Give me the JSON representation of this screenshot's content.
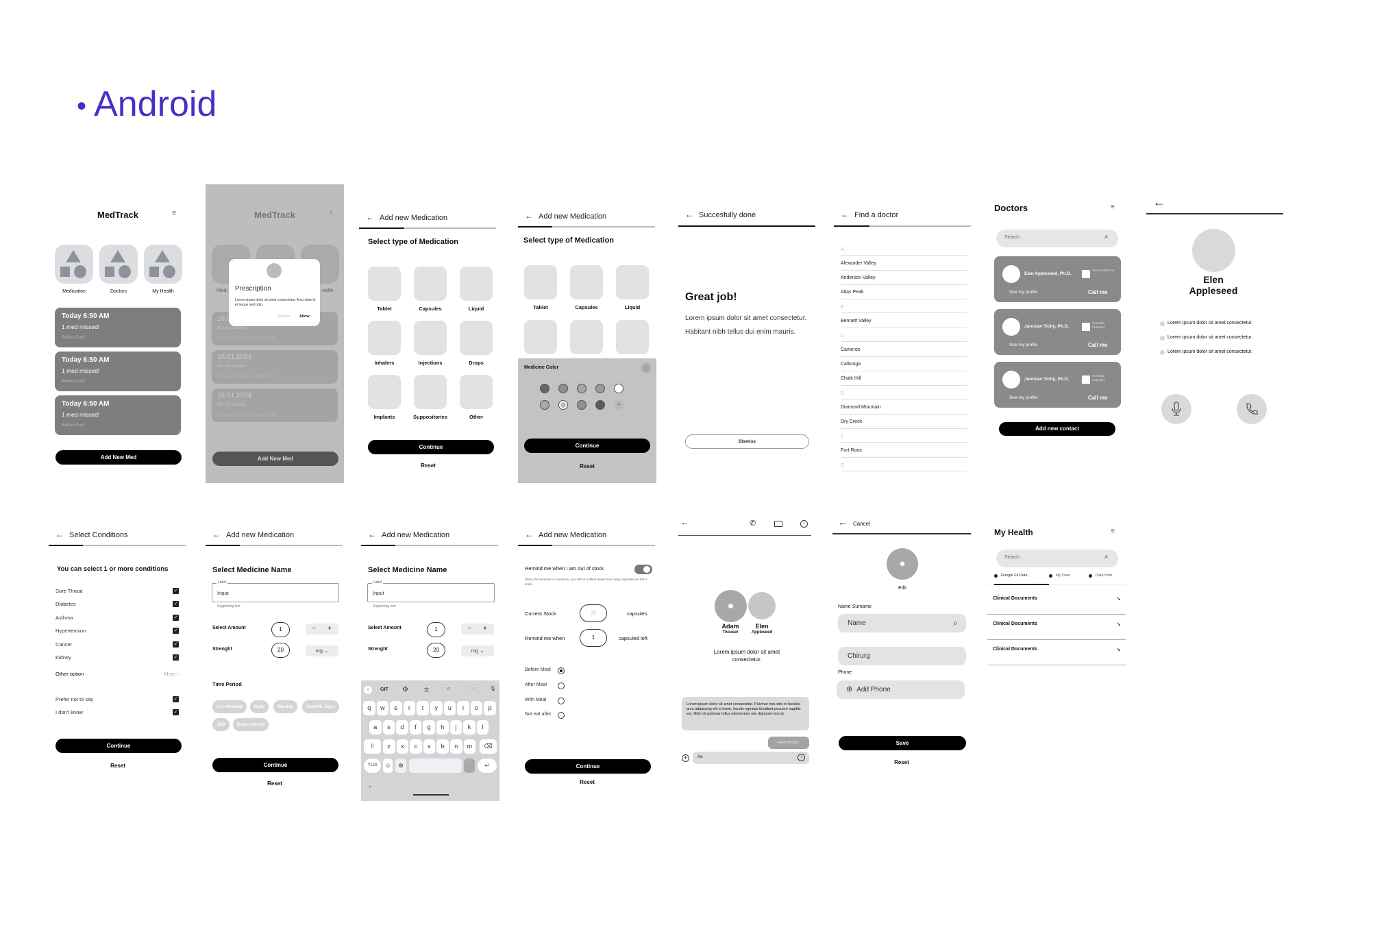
{
  "page_title": "Android",
  "colors": {
    "title": "#4b2ec4",
    "button": "#000000",
    "card": "#7e7e7e",
    "overlay": "#bdbdbd"
  },
  "home": {
    "title": "MedTrack",
    "menu_icon": "hamburger-icon",
    "categories": [
      "Medication",
      "Doctors",
      "My Health"
    ],
    "cards": [
      {
        "time": "Today 6:50 AM",
        "status": "1 med missed!",
        "note": "Before food"
      },
      {
        "time": "Today 6:50 AM",
        "status": "1 med missed!",
        "note": "Before food"
      },
      {
        "time": "Today 6:50 AM",
        "status": "1 med missed!",
        "note": "Before food"
      }
    ],
    "add_button": "Add New Med"
  },
  "dialog_screen": {
    "title": "MedTrack",
    "category_partials": [
      "Medi",
      "ealth"
    ],
    "dialog": {
      "title": "Prescription",
      "body": "Lorem ipsum dolor sit amet consectetur. Arcu vitae id et neque sed odio.",
      "dismiss": "Dismiss",
      "allow": "Allow"
    },
    "cards": [
      {
        "date": "16.0",
        "event": "Run for Ukraine",
        "place": "Prague City Center - Holes Pub"
      },
      {
        "date": "16.01.2024",
        "event": "Run for Ukraine",
        "place": "Prague City Center - Holes Pub"
      },
      {
        "date": "16.01.2024",
        "event": "Run for Ukraine",
        "place": "Prague City Center - Holes Pub"
      }
    ],
    "add_button": "Add New Med"
  },
  "med_type": {
    "header": "Add new Medication",
    "title": "Select type of Medication",
    "types": [
      "Tablet",
      "Capsules",
      "Liquid",
      "Inhalers",
      "Injections",
      "Drops",
      "Implants",
      "Suppositories",
      "Other"
    ],
    "continue": "Continue",
    "reset": "Reset"
  },
  "med_color": {
    "header": "Add new Medication",
    "title": "Select type of Medication",
    "types": [
      "Tablet",
      "Capsules",
      "Liquid",
      "Inhalers",
      "Injections",
      "Drops"
    ],
    "sheet_title": "Medicine Color",
    "colors": [
      "#666666",
      "#8e8e8e",
      "#a6a6a6",
      "#9a9a9a",
      "#ffffff",
      "#a8a8a8",
      "#bcbcbc",
      "#8f8f95",
      "#5f5a5a"
    ],
    "selected_color_index": 6,
    "continue": "Continue",
    "reset": "Reset"
  },
  "success": {
    "header": "Succesfully done",
    "title": "Great job!",
    "body": "Lorem ipsum dolor sit amet consectetur. Habitant nibh tellus dui enim mauris.",
    "dismiss": "Dismiss"
  },
  "find_doctor": {
    "header": "Find a doctor",
    "groups": [
      {
        "letter": "A",
        "items": [
          "Alexander Valley",
          "Anderson Valley",
          "Atlas Peak"
        ]
      },
      {
        "letter": "B",
        "items": [
          "Bennett Valley"
        ]
      },
      {
        "letter": "C",
        "items": [
          "Cameros",
          "Calistoga",
          "Chalk Hill"
        ]
      },
      {
        "letter": "D",
        "items": [
          "Diamond Mountain",
          "Dry Creek"
        ]
      },
      {
        "letter": "F",
        "items": [
          "Fort Roos"
        ]
      },
      {
        "letter": "G",
        "items": []
      }
    ]
  },
  "doctors": {
    "title": "Doctors",
    "search_placeholder": "Search",
    "cards": [
      {
        "name": "Elen Appleseed, Ph.D.",
        "tag": "Tenzin Medicine",
        "profile": "See my profile",
        "call": "Call me"
      },
      {
        "name": "Jaroslav Tichý, Ph.D.",
        "tag": "Hemolob Capsules",
        "profile": "See my profile",
        "call": "Call me"
      },
      {
        "name": "Jaroslav Tichý, Ph.D.",
        "tag": "Hemolob Capsules",
        "profile": "See my profile",
        "call": "Call me"
      }
    ],
    "add_contact": "Add new contact"
  },
  "profile": {
    "name_first": "Elen",
    "name_last": "Appleseed",
    "bullets": [
      "Lorem ipsum dolor sit amet consectetur.",
      "Lorem ipsum dolor sit amet consectetur.",
      "Lorem ipsum dolor sit amet consectetur."
    ]
  },
  "conditions": {
    "header": "Select Conditions",
    "title": "You can select 1 or more conditions",
    "items": [
      "Sore Throat",
      "Diabetes",
      "Asthma",
      "Hypertension",
      "Cancer",
      "Kidney"
    ],
    "other_option": "Other option",
    "more": "More",
    "extra": [
      "Prefer not to say",
      "I don't know"
    ],
    "continue": "Continue",
    "reset": "Reset"
  },
  "med_name": {
    "header": "Add new Medication",
    "title": "Select Medicine Name",
    "field_label": "Label",
    "field_value": "Input",
    "supporting": "Supporting text",
    "amount_label": "Select Amount",
    "amount": "1",
    "strength_label": "Strenght",
    "strength": "20",
    "unit": "mg",
    "time_period": "Time Period",
    "chips": [
      "Ass Needed",
      "Daily",
      "Weekly",
      "Specific Days",
      "30D",
      "Days Interval"
    ],
    "continue": "Continue",
    "reset": "Reset"
  },
  "keyboard": {
    "toolbar": [
      "GIF"
    ],
    "rows": [
      [
        "q",
        "w",
        "e",
        "r",
        "t",
        "y",
        "u",
        "i",
        "o",
        "p"
      ],
      [
        "a",
        "s",
        "d",
        "f",
        "g",
        "h",
        "j",
        "k",
        "l"
      ],
      [
        "z",
        "x",
        "c",
        "v",
        "b",
        "n",
        "m"
      ]
    ],
    "sym": "?123"
  },
  "stock": {
    "header": "Add new Medication",
    "remind_label": "Remind me when I am out of stock",
    "remind_on": true,
    "remind_help": "When the reminder is turned on, you will be notified about how many capsules are left in stock.",
    "current_stock_label": "Current Stock",
    "current_stock": "20",
    "current_stock_unit": "capsules",
    "remind_when_label": "Remind me when",
    "remind_when": "1",
    "remind_when_unit": "capsuled left",
    "meal_options": [
      "Before Meal",
      "After Meal",
      "With Meal",
      "Not eat after"
    ],
    "selected_meal": 0,
    "continue": "Continue",
    "reset": "Reset"
  },
  "chat": {
    "user1_first": "Adam",
    "user1_last": "Theuser",
    "user2_first": "Elen",
    "user2_last": "Appleseed",
    "intro": "Lorem ipsum dolor sit amet consectetur.",
    "message": "Lorem ipsum dolor sit amet consectetur. Pulvinar nisi odio in facilisis arcu adipiscing elit a lorem. Iaculis egestas tincidunt posuere sagittis est. Nibh sit pulvinar tellus elementum nisi dignissim dui at.",
    "reply": "Hello Doctor.",
    "input_placeholder": "Aa"
  },
  "edit_contact": {
    "cancel": "Cancel",
    "edit": "Edit",
    "name_label": "Name Surname",
    "name_placeholder": "Name",
    "specialty": "Chirurg",
    "phone_label": "Phone",
    "add_phone": "Add Phone",
    "save": "Save",
    "reset": "Reset"
  },
  "my_health": {
    "title": "My Health",
    "search_placeholder": "Search",
    "tabs": [
      "Google Fit Data",
      "My Data",
      "Data from"
    ],
    "active_tab": 0,
    "items": [
      "Clinical Documents",
      "Clinical Documents",
      "Clinical Documents"
    ]
  }
}
